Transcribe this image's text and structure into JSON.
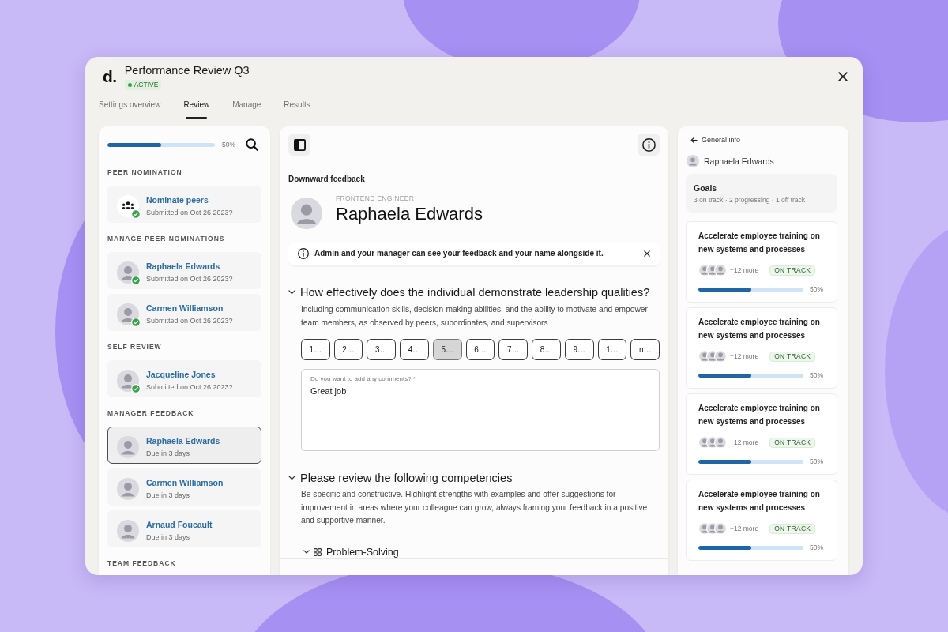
{
  "window": {
    "logo": "d.",
    "title": "Performance Review Q3",
    "status": "ACTIVE"
  },
  "tabs": [
    {
      "label": "Settings overview",
      "selected": false
    },
    {
      "label": "Review",
      "selected": true
    },
    {
      "label": "Manage",
      "selected": false
    },
    {
      "label": "Results",
      "selected": false
    }
  ],
  "sidebar": {
    "progress": {
      "level": 0.5,
      "reading": "50%"
    },
    "sections": [
      {
        "title": "PEER NOMINATION",
        "items": [
          {
            "kind": "group",
            "name": "Nominate peers",
            "detail": "Submitted on Oct 26 2023?",
            "done": true,
            "selected": false
          }
        ]
      },
      {
        "title": "MANAGE PEER NOMINATIONS",
        "items": [
          {
            "kind": "person",
            "name": "Raphaela Edwards",
            "detail": "Submitted on Oct 26 2023?",
            "done": true,
            "selected": false
          },
          {
            "kind": "person",
            "name": "Carmen Williamson",
            "detail": "Submitted on Oct 26 2023?",
            "done": true,
            "selected": false
          }
        ]
      },
      {
        "title": "SELF REVIEW",
        "items": [
          {
            "kind": "person",
            "name": "Jacqueline Jones",
            "detail": "Submitted on Oct 26 2023?",
            "done": true,
            "selected": false
          }
        ]
      },
      {
        "title": "MANAGER FEEDBACK",
        "items": [
          {
            "kind": "person",
            "name": "Raphaela Edwards",
            "detail": "Due in 3 days",
            "done": false,
            "selected": true
          },
          {
            "kind": "person",
            "name": "Carmen Williamson",
            "detail": "Due in 3 days",
            "done": false,
            "selected": false
          },
          {
            "kind": "person",
            "name": "Arnaud Foucault",
            "detail": "Due in 3 days",
            "done": false,
            "selected": false
          }
        ]
      },
      {
        "title": "TEAM FEEDBACK"
      }
    ]
  },
  "feedback": {
    "type_label": "Downward feedback",
    "person": {
      "role": "FRONTEND ENGINEER",
      "name": "Raphaela Edwards"
    },
    "notice": "Admin and your manager can see your feedback and your name alongside it.",
    "questions": [
      {
        "kind": "rating",
        "expanded": true,
        "title": "How effectively does the individual demonstrate leadership qualities?",
        "description": "Including communication skills, decision-making abilities, and the ability to motivate and empower team members, as observed by peers, subordinates, and supervisors",
        "options": [
          {
            "label": "1…",
            "selected": false
          },
          {
            "label": "2…",
            "selected": false
          },
          {
            "label": "3…",
            "selected": false
          },
          {
            "label": "4…",
            "selected": false
          },
          {
            "label": "5…",
            "selected": true
          },
          {
            "label": "6…",
            "selected": false
          },
          {
            "label": "7…",
            "selected": false
          },
          {
            "label": "8…",
            "selected": false
          },
          {
            "label": "9…",
            "selected": false
          },
          {
            "label": "1…",
            "selected": false
          },
          {
            "label": "n…",
            "selected": false
          }
        ],
        "comment": {
          "label": "Do you want to add any comments? *",
          "value": "Great job"
        }
      },
      {
        "kind": "competencies",
        "expanded": true,
        "title": "Please review the following competencies",
        "description": "Be specific and constructive. Highlight strengths with examples and offer suggestions for improvement in areas where your colleague can grow, always framing your feedback in a positive and supportive manner.",
        "competencies": [
          {
            "name": "Problem-Solving",
            "expanded": true
          }
        ]
      }
    ]
  },
  "details": {
    "back_label": "General info",
    "person_name": "Raphaela Edwards",
    "goals": {
      "title": "Goals",
      "summary": "3 on track · 2 progressing · 1 off track",
      "items": [
        {
          "title": "Accelerate employee training on new systems and processes",
          "more": "+12 more",
          "status": "ON TRACK",
          "level": 0.5,
          "reading": "50%"
        },
        {
          "title": "Accelerate employee training on new systems and processes",
          "more": "+12 more",
          "status": "ON TRACK",
          "level": 0.5,
          "reading": "50%"
        },
        {
          "title": "Accelerate employee training on new systems and processes",
          "more": "+12 more",
          "status": "ON TRACK",
          "level": 0.5,
          "reading": "50%"
        },
        {
          "title": "Accelerate employee training on new systems and processes",
          "more": "+12 more",
          "status": "ON TRACK",
          "level": 0.5,
          "reading": "50%"
        }
      ]
    }
  }
}
